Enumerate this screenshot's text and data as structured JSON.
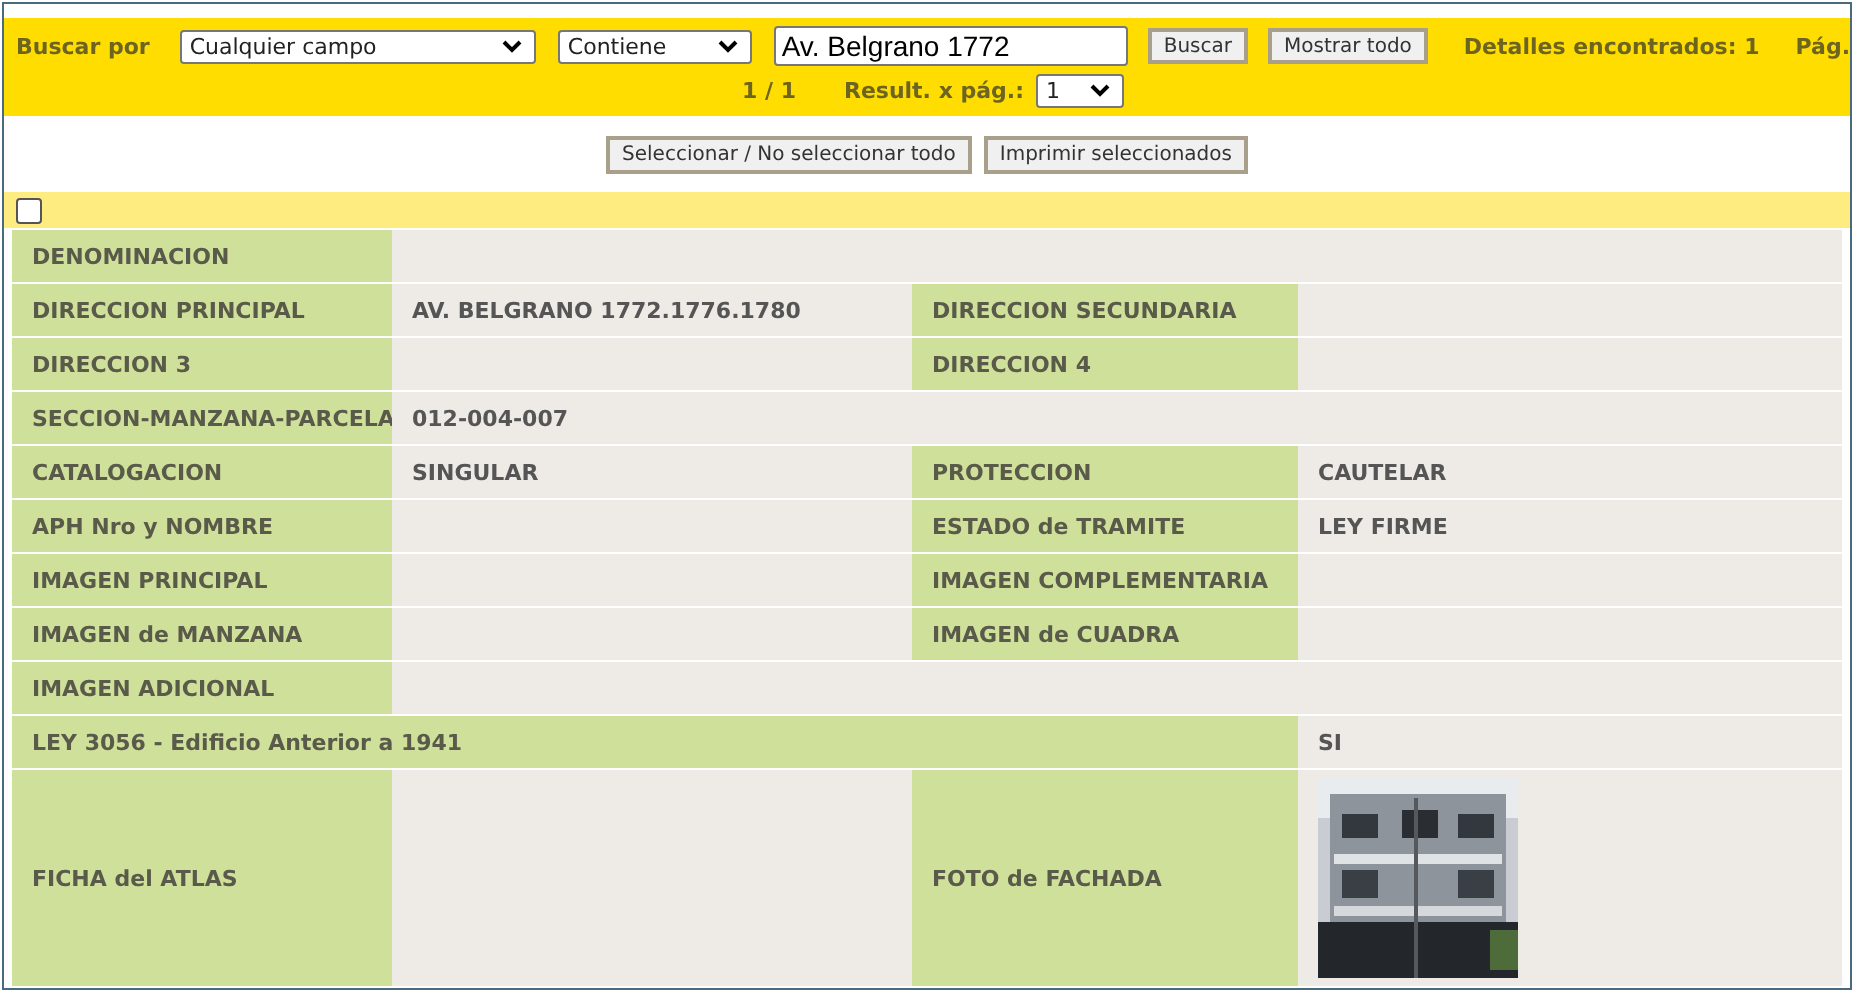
{
  "search_bar": {
    "label": "Buscar por",
    "field_select": "Cualquier campo",
    "mode_select": "Contiene",
    "query": "Av. Belgrano 1772",
    "search_button": "Buscar",
    "show_all_button": "Mostrar todo",
    "found": "Detalles encontrados: 1",
    "page_label": "Pág.",
    "page": "1 / 1",
    "per_page_label": "Result. x pág.:",
    "per_page": "1"
  },
  "actions": [
    "Seleccionar / No seleccionar todo",
    "Imprimir seleccionados"
  ],
  "select_all": {
    "checked": false
  },
  "rows": [
    {
      "kind": "single",
      "label": "DENOMINACION"
    },
    {
      "kind": "pair",
      "label": "DIRECCION PRINCIPAL",
      "value": "AV. BELGRANO 1772.1776.1780",
      "label_2": "DIRECCION SECUNDARIA"
    },
    {
      "kind": "pair",
      "label": "DIRECCION 3",
      "label_2": "DIRECCION 4"
    },
    {
      "kind": "single",
      "label": "SECCION-MANZANA-PARCELA",
      "value": "012-004-007"
    },
    {
      "kind": "pair",
      "label": "CATALOGACION",
      "value": "SINGULAR",
      "label_2": "PROTECCION",
      "value_2": "CAUTELAR"
    },
    {
      "kind": "pair",
      "label": "APH Nro y NOMBRE",
      "label_2": "ESTADO de TRAMITE",
      "value_2": "LEY FIRME"
    },
    {
      "kind": "pair",
      "label": "IMAGEN PRINCIPAL",
      "label_2": "IMAGEN COMPLEMENTARIA"
    },
    {
      "kind": "pair",
      "label": "IMAGEN de MANZANA",
      "label_2": "IMAGEN de CUADRA"
    },
    {
      "kind": "single",
      "label": "IMAGEN ADICIONAL"
    },
    {
      "kind": "wide",
      "label": "LEY 3056 - Edificio Anterior a 1941",
      "value": "SI"
    },
    {
      "label": "FICHA del ATLAS",
      "label_2": "FOTO de FACHADA"
    }
  ]
}
